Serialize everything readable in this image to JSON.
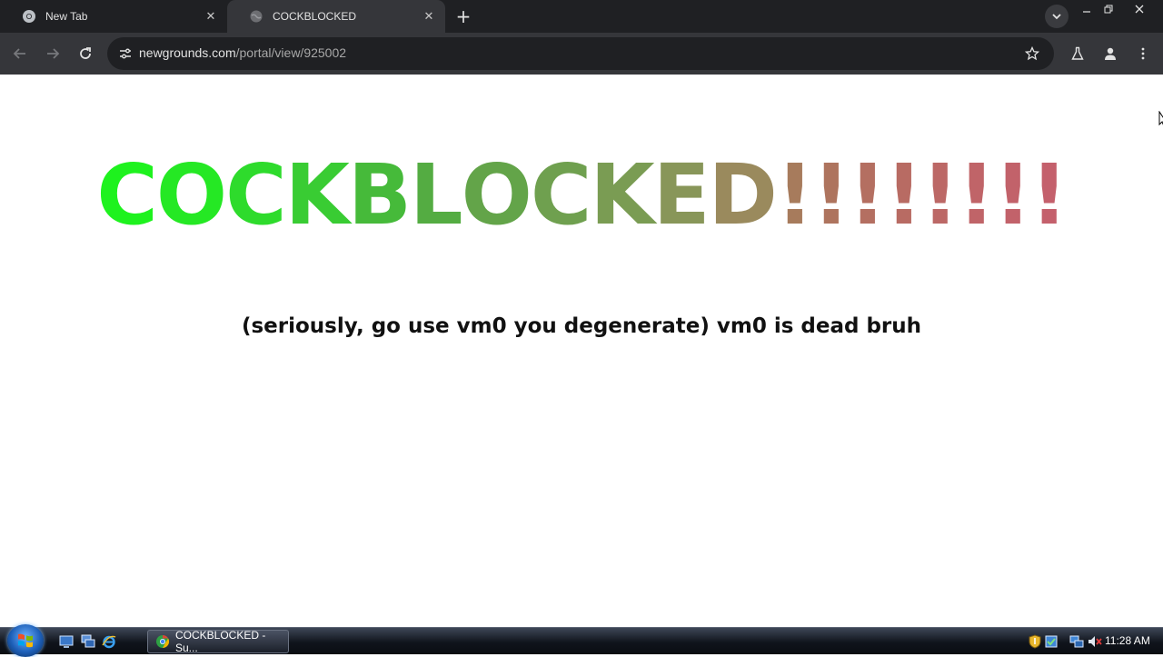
{
  "browser": {
    "tabs": [
      {
        "title": "New Tab",
        "favicon": "chrome-icon",
        "active": false
      },
      {
        "title": "COCKBLOCKED",
        "favicon": "globe-icon",
        "active": true
      }
    ],
    "address_bar": {
      "url_host": "newgrounds.com",
      "url_path": "/portal/view/925002"
    },
    "theme": {
      "frame": "#1f2023",
      "toolbar": "#35363a",
      "omnibox": "#1f2023"
    }
  },
  "page": {
    "headline_letters": [
      {
        "ch": "C",
        "color": "#1ef21e"
      },
      {
        "ch": "O",
        "color": "#25e824"
      },
      {
        "ch": "C",
        "color": "#2edb2c"
      },
      {
        "ch": "K",
        "color": "#39cc33"
      },
      {
        "ch": "B",
        "color": "#46ba3a"
      },
      {
        "ch": "L",
        "color": "#54ac42"
      },
      {
        "ch": "O",
        "color": "#63a449"
      },
      {
        "ch": "C",
        "color": "#6fa04f"
      },
      {
        "ch": "K",
        "color": "#7a9c53"
      },
      {
        "ch": "E",
        "color": "#889659"
      },
      {
        "ch": "D",
        "color": "#9a8a5d"
      },
      {
        "ch": "!",
        "color": "#a77b5c"
      },
      {
        "ch": "!",
        "color": "#ae745e"
      },
      {
        "ch": "!",
        "color": "#b46f61"
      },
      {
        "ch": "!",
        "color": "#b86b63"
      },
      {
        "ch": "!",
        "color": "#bc6866"
      },
      {
        "ch": "!",
        "color": "#c06468"
      },
      {
        "ch": "!",
        "color": "#c2626a"
      },
      {
        "ch": "!",
        "color": "#c4606c"
      }
    ],
    "subtitle": "(seriously, go use vm0 you degenerate) vm0 is dead bruh"
  },
  "taskbar": {
    "task_button_label": "COCKBLOCKED - Su...",
    "clock": "11:28 AM"
  }
}
